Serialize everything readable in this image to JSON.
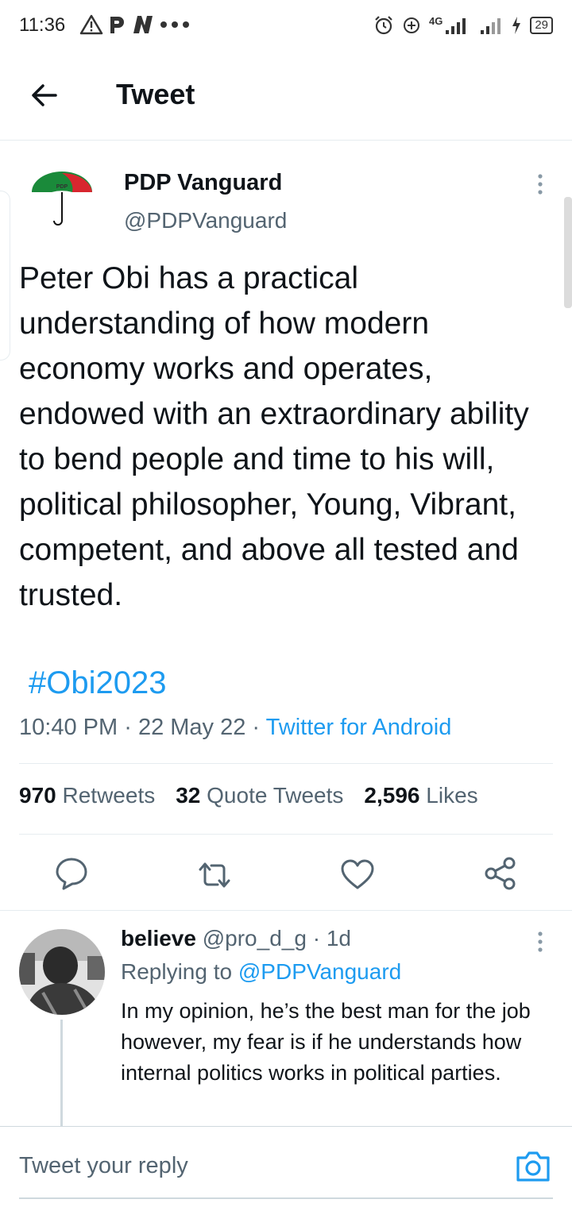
{
  "status_bar": {
    "time": "11:36",
    "left_icons": [
      "warning-icon",
      "p-app-icon",
      "n-app-icon",
      "more-dots-icon"
    ],
    "network_label": "4G",
    "battery": "29"
  },
  "header": {
    "title": "Tweet"
  },
  "tweet": {
    "author_name": "PDP Vanguard",
    "author_handle": "@PDPVanguard",
    "avatar_label": "PDP",
    "text": "Peter Obi has a practical understanding of how modern economy works and operates, endowed with an extraordinary ability to bend people and time to his will, political philosopher, Young, Vibrant, competent, and above all tested and trusted.",
    "hashtag": "#Obi2023",
    "time": "10:40 PM",
    "date": "22 May 22",
    "source": "Twitter for Android",
    "sep": "·",
    "stats": {
      "retweets_count": "970",
      "retweets_label": "Retweets",
      "quotes_count": "32",
      "quotes_label": "Quote Tweets",
      "likes_count": "2,596",
      "likes_label": "Likes"
    }
  },
  "reply": {
    "name": "believe",
    "handle": "@pro_d_g",
    "age": "1d",
    "sep": "·",
    "replying_prefix": "Replying to",
    "replying_to": "@PDPVanguard",
    "text": "In my opinion, he’s the best man for the job however, my fear is if he understands how internal politics works in political parties."
  },
  "compose": {
    "placeholder": "Tweet your reply"
  },
  "colors": {
    "accent": "#1d9bf0",
    "text": "#0f1419",
    "secondary": "#536471"
  }
}
